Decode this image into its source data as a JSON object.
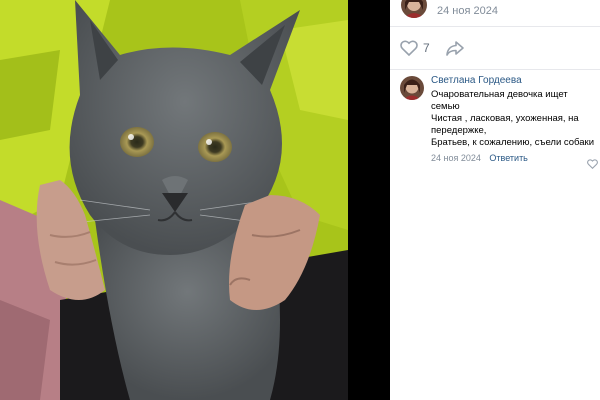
{
  "post": {
    "date": "24 ноя 2024",
    "likes_count": "7"
  },
  "comment": {
    "author": "Светлана Гордеева",
    "lines": [
      "Очаровательная девочка ищет семью",
      "Чистая , ласковая, ухоженная, на передержке,",
      "Братьев, к сожалению, съели собаки"
    ],
    "date": "24 ноя 2024",
    "reply_label": "Ответить"
  },
  "colors": {
    "link": "#2a5885",
    "muted": "#818c99",
    "jacket": "#b9d41e",
    "cat_fur": "#5f6366"
  },
  "icons": {
    "like": "heart-outline-icon",
    "share": "share-arrow-icon",
    "comment_like": "heart-outline-icon"
  }
}
